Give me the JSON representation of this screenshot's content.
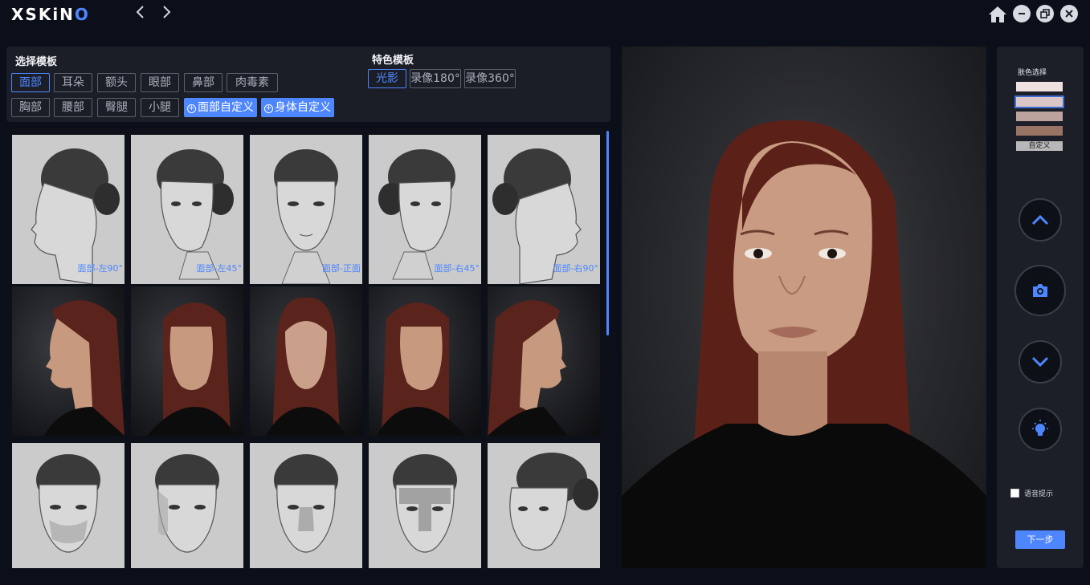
{
  "app": {
    "logo_prefix": "XSKiN",
    "logo_suffix": "O",
    "back_icon": "chevron-left-icon",
    "forward_icon": "chevron-right-icon"
  },
  "templates": {
    "title": "选择模板",
    "categories": [
      "面部",
      "耳朵",
      "额头",
      "眼部",
      "鼻部",
      "肉毒素",
      "胸部",
      "腰部",
      "臀腿",
      "小腿"
    ],
    "selected_category": "面部",
    "custom_face": "面部自定义",
    "custom_body": "身体自定义"
  },
  "special": {
    "title": "特色模板",
    "items": [
      "光影",
      "录像180°",
      "录像360°"
    ],
    "selected": "光影"
  },
  "thumbnails": {
    "row1_captions": [
      "面部-左90°",
      "面部-左45°",
      "面部-正面",
      "面部-右45°",
      "面部-右90°"
    ]
  },
  "controls": {
    "skin_title": "肤色选择",
    "skin_swatches": [
      "#efe1e0",
      "#dac6c6",
      "#bda39d",
      "#997465"
    ],
    "selected_swatch_index": 1,
    "custom_label": "自定义",
    "voice_label": "语音提示",
    "voice_checked": false,
    "next_label": "下一步"
  },
  "colors": {
    "accent": "#4e86ff",
    "background": "#0b0f1a",
    "panel": "#1b1e27"
  }
}
